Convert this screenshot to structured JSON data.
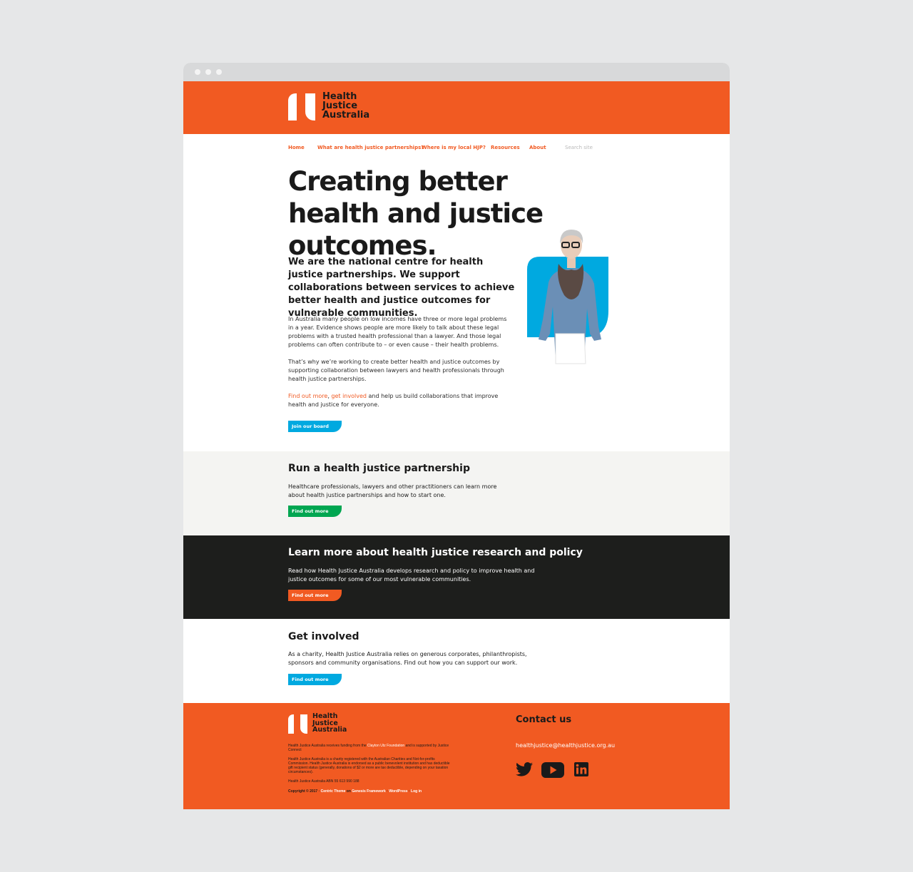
{
  "brand": {
    "name_lines": [
      "Health",
      "Justice",
      "Australia"
    ],
    "colors": {
      "orange": "#f15a22",
      "blue": "#00a9e0",
      "green": "#00a651",
      "dark": "#1d1e1c",
      "light_grey": "#f4f4f2"
    }
  },
  "nav": {
    "items": [
      "Home",
      "What are health justice partnerships?",
      "Where is my local HJP?",
      "Resources",
      "About"
    ],
    "search_placeholder": "Search site"
  },
  "hero": {
    "title": "Creating better health and justice outcomes.",
    "lede": "We are the national centre for health justice partnerships. We support collaborations between services to achieve better health and justice outcomes for vulnerable communities.",
    "para1": "In Australia many people on low incomes have three or more legal problems in a year. Evidence shows people are more likely to talk about these legal problems with a trusted health professional than a lawyer. And those legal problems can often contribute to – or even cause – their health problems.",
    "para2": "That’s why we’re working to create better health and justice outcomes by supporting collaboration between lawyers and health professionals through health justice partnerships.",
    "para3_link1": "Find out more",
    "para3_sep": ", ",
    "para3_link2": "get involved",
    "para3_rest": " and help us build collaborations that improve health and justice for everyone.",
    "button": "Join our board"
  },
  "section_run": {
    "title": "Run a health justice partnership",
    "text": "Healthcare professionals, lawyers and other practitioners can learn more about health justice partnerships and how to start one.",
    "button": "Find out more"
  },
  "section_research": {
    "title": "Learn more about health justice research and policy",
    "text": "Read how Health Justice Australia develops research and policy to improve health and justice outcomes for some of our most vulnerable communities.",
    "button": "Find out more"
  },
  "section_involved": {
    "title": "Get involved",
    "text": "As a charity, Health Justice Australia relies on generous corporates, philanthropists, sponsors and community organisations. Find out how you can support our work.",
    "button": "Find out more"
  },
  "footer": {
    "funding_pre": "Health Justice Australia receives funding from the ",
    "funding_link": "Clayton Utz Foundation",
    "funding_post": " and is supported by Justice Connect",
    "charity": "Health Justice Australia is a charity registered with the Australian Charities and Not-for-profits Commission. Health Justice Australia is endorsed as a public benevolent institution and has deductible gift recipient status (generally, donations of $2 or more are tax deductible, depending on your taxation circumstances).",
    "abn": "Health Justice Australia ABN 55 613 990 188",
    "copyright": "Copyright © 2017 · ",
    "theme": "Centric Theme",
    "on": " on ",
    "framework": "Genesis Framework",
    "sep1": " · ",
    "wordpress": "WordPress",
    "sep2": " · ",
    "login": "Log in",
    "contact_title": "Contact us",
    "email": "healthjustice@healthjustice.org.au",
    "social_icons": [
      "twitter-icon",
      "youtube-icon",
      "linkedin-icon"
    ]
  }
}
